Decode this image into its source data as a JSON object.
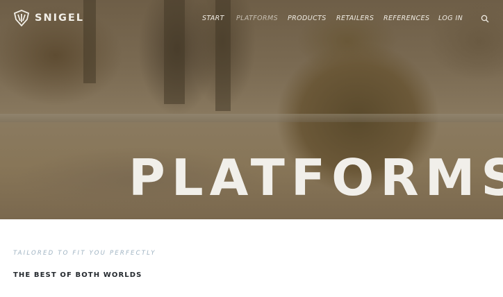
{
  "brand": {
    "name": "SNIGEL",
    "logo_icon": "snigel-shield-icon"
  },
  "nav": {
    "items": [
      {
        "label": "START",
        "active": false
      },
      {
        "label": "PLATFORMS",
        "active": true
      },
      {
        "label": "PRODUCTS",
        "active": false
      },
      {
        "label": "RETAILERS",
        "active": false
      },
      {
        "label": "REFERENCES",
        "active": false
      },
      {
        "label": "LOG IN",
        "active": false
      }
    ],
    "search_icon": "search-icon"
  },
  "hero": {
    "title": "PLATFORMS"
  },
  "content": {
    "tagline": "TAILORED TO FIT YOU PERFECTLY",
    "subhead": "THE BEST OF BOTH WORLDS"
  },
  "colors": {
    "hero_text": "#f1efea",
    "tagline": "#9fb3c2",
    "subhead": "#24292e",
    "nav_active": "#c7bfb2"
  }
}
